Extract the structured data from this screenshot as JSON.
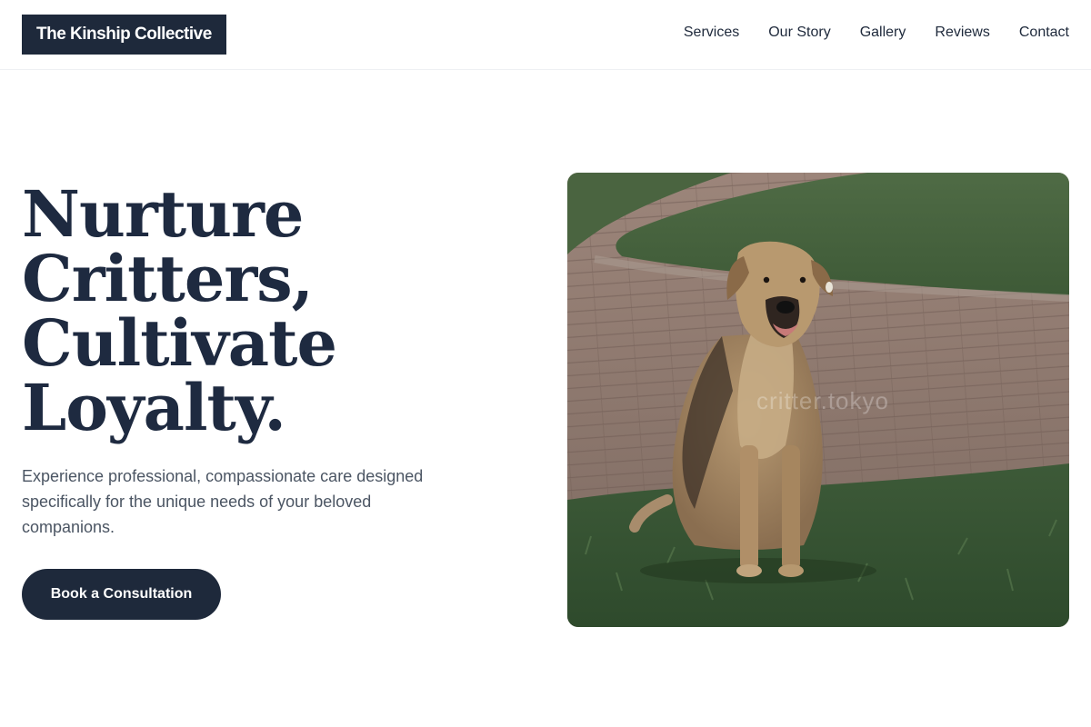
{
  "brand": {
    "name": "The Kinship Collective"
  },
  "nav": {
    "items": [
      "Services",
      "Our Story",
      "Gallery",
      "Reviews",
      "Contact"
    ]
  },
  "hero": {
    "title_lines": [
      "Nurture",
      "Critters,",
      "Cultivate",
      "Loyalty."
    ],
    "subtitle": "Experience professional, compassionate care designed specifically for the unique needs of your beloved companions.",
    "cta_label": "Book a Consultation",
    "image": {
      "subject": "dog sitting on grass beside brick path",
      "watermark": "critter.tokyo"
    }
  },
  "colors": {
    "primary": "#1e293b",
    "heading": "#1e2a40",
    "body_text": "#4b5563",
    "background": "#ffffff",
    "grass": "#3f5a3a",
    "path": "#8a7468"
  }
}
